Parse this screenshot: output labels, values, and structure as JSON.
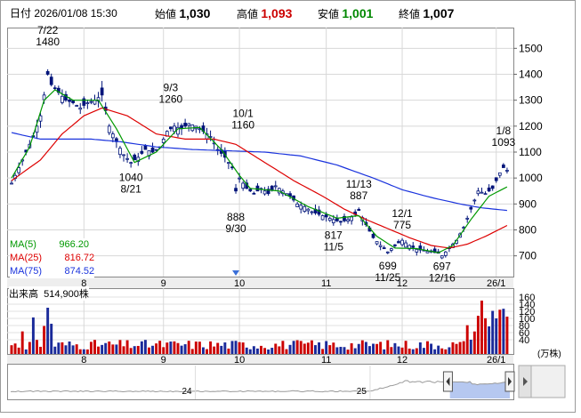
{
  "header": {
    "period": "日付",
    "datetime": "2026/01/08 15:30",
    "open_label": "始値",
    "open_value": "1,030",
    "high_label": "高値",
    "high_value": "1,093",
    "low_label": "安値",
    "low_value": "1,001",
    "close_label": "終値",
    "close_value": "1,007"
  },
  "colors": {
    "ma5": "#009900",
    "ma25": "#dd0000",
    "ma75": "#1a33dd",
    "up": "#ffffff",
    "down": "#00147a",
    "volume_up": "#cc0000",
    "volume_down": "#1a2a9a",
    "high_value": "#cc0000",
    "low_value": "#008800",
    "navigator_fill": "#b6c8f0"
  },
  "legend": [
    {
      "label": "MA(5)",
      "value": "966.20",
      "color": "#009900"
    },
    {
      "label": "MA(25)",
      "value": "816.72",
      "color": "#dd0000"
    },
    {
      "label": "MA(75)",
      "value": "874.52",
      "color": "#1a33dd"
    }
  ],
  "volume_label": "出来高",
  "volume_value": "514,900株",
  "chart_data": {
    "type": "candlestick",
    "ylim": [
      620,
      1580
    ],
    "yticks": [
      700,
      800,
      900,
      1000,
      1100,
      1200,
      1300,
      1400,
      1500
    ],
    "month_ticks": [
      {
        "label": "8",
        "index": 20
      },
      {
        "label": "9",
        "index": 42
      },
      {
        "label": "10",
        "index": 63
      },
      {
        "label": "11",
        "index": 87
      },
      {
        "label": "12",
        "index": 108
      },
      {
        "label": "26/1",
        "index": 134
      }
    ],
    "current_marker_index": 62,
    "annotations": [
      {
        "date": "7/22",
        "value": "1480",
        "index": 10,
        "position": "above"
      },
      {
        "date": "9/3",
        "value": "1260",
        "index": 44,
        "position": "above"
      },
      {
        "date": "10/1",
        "value": "1160",
        "index": 64,
        "position": "above"
      },
      {
        "date": "11/13",
        "value": "887",
        "index": 96,
        "position": "above"
      },
      {
        "date": "12/1",
        "value": "775",
        "index": 108,
        "position": "above"
      },
      {
        "date": "1/8",
        "value": "1093",
        "index": 136,
        "position": "above"
      },
      {
        "date": "8/21",
        "value": "1040",
        "index": 33,
        "position": "below"
      },
      {
        "date": "9/30",
        "value": "888",
        "index": 62,
        "position": "below"
      },
      {
        "date": "11/5",
        "value": "817",
        "index": 89,
        "position": "below"
      },
      {
        "date": "11/25",
        "value": "699",
        "index": 104,
        "position": "below"
      },
      {
        "date": "12/16",
        "value": "697",
        "index": 119,
        "position": "below"
      }
    ],
    "anchors_close": [
      [
        0,
        980
      ],
      [
        2,
        1040
      ],
      [
        4,
        1100
      ],
      [
        6,
        1160
      ],
      [
        8,
        1240
      ],
      [
        10,
        1400
      ],
      [
        11,
        1360
      ],
      [
        13,
        1330
      ],
      [
        15,
        1300
      ],
      [
        17,
        1290
      ],
      [
        19,
        1270
      ],
      [
        21,
        1290
      ],
      [
        23,
        1300
      ],
      [
        25,
        1320
      ],
      [
        27,
        1200
      ],
      [
        29,
        1140
      ],
      [
        31,
        1090
      ],
      [
        33,
        1060
      ],
      [
        35,
        1080
      ],
      [
        37,
        1110
      ],
      [
        39,
        1100
      ],
      [
        41,
        1120
      ],
      [
        43,
        1180
      ],
      [
        45,
        1200
      ],
      [
        47,
        1190
      ],
      [
        49,
        1210
      ],
      [
        51,
        1200
      ],
      [
        53,
        1180
      ],
      [
        55,
        1160
      ],
      [
        57,
        1110
      ],
      [
        59,
        1080
      ],
      [
        61,
        1040
      ],
      [
        62,
        950
      ],
      [
        63,
        1000
      ],
      [
        65,
        960
      ],
      [
        67,
        940
      ],
      [
        69,
        960
      ],
      [
        71,
        940
      ],
      [
        73,
        970
      ],
      [
        75,
        950
      ],
      [
        77,
        930
      ],
      [
        79,
        900
      ],
      [
        81,
        890
      ],
      [
        83,
        870
      ],
      [
        85,
        860
      ],
      [
        87,
        850
      ],
      [
        89,
        840
      ],
      [
        91,
        830
      ],
      [
        93,
        840
      ],
      [
        95,
        860
      ],
      [
        96,
        875
      ],
      [
        98,
        820
      ],
      [
        100,
        770
      ],
      [
        102,
        740
      ],
      [
        104,
        715
      ],
      [
        106,
        740
      ],
      [
        108,
        760
      ],
      [
        110,
        740
      ],
      [
        112,
        725
      ],
      [
        114,
        720
      ],
      [
        116,
        715
      ],
      [
        118,
        710
      ],
      [
        119,
        700
      ],
      [
        121,
        730
      ],
      [
        123,
        760
      ],
      [
        125,
        810
      ],
      [
        127,
        880
      ],
      [
        129,
        950
      ],
      [
        131,
        940
      ],
      [
        133,
        960
      ],
      [
        135,
        1020
      ],
      [
        136,
        1040
      ],
      [
        137,
        1030
      ]
    ],
    "ma5_anchors": [
      [
        0,
        1000
      ],
      [
        5,
        1120
      ],
      [
        9,
        1300
      ],
      [
        12,
        1340
      ],
      [
        17,
        1300
      ],
      [
        24,
        1300
      ],
      [
        29,
        1190
      ],
      [
        34,
        1060
      ],
      [
        40,
        1100
      ],
      [
        46,
        1190
      ],
      [
        52,
        1195
      ],
      [
        58,
        1110
      ],
      [
        63,
        1010
      ],
      [
        66,
        960
      ],
      [
        74,
        950
      ],
      [
        82,
        890
      ],
      [
        90,
        845
      ],
      [
        96,
        855
      ],
      [
        101,
        775
      ],
      [
        106,
        730
      ],
      [
        112,
        728
      ],
      [
        118,
        712
      ],
      [
        122,
        740
      ],
      [
        127,
        840
      ],
      [
        132,
        930
      ],
      [
        137,
        966
      ]
    ],
    "ma25_anchors": [
      [
        0,
        990
      ],
      [
        8,
        1070
      ],
      [
        14,
        1170
      ],
      [
        20,
        1240
      ],
      [
        25,
        1270
      ],
      [
        32,
        1240
      ],
      [
        40,
        1170
      ],
      [
        48,
        1150
      ],
      [
        56,
        1150
      ],
      [
        62,
        1130
      ],
      [
        70,
        1060
      ],
      [
        78,
        990
      ],
      [
        86,
        930
      ],
      [
        92,
        880
      ],
      [
        98,
        840
      ],
      [
        104,
        805
      ],
      [
        110,
        770
      ],
      [
        116,
        740
      ],
      [
        121,
        730
      ],
      [
        126,
        745
      ],
      [
        131,
        775
      ],
      [
        137,
        817
      ]
    ],
    "ma75_anchors": [
      [
        0,
        1175
      ],
      [
        8,
        1150
      ],
      [
        14,
        1150
      ],
      [
        22,
        1150
      ],
      [
        30,
        1140
      ],
      [
        40,
        1120
      ],
      [
        50,
        1110
      ],
      [
        60,
        1105
      ],
      [
        70,
        1100
      ],
      [
        80,
        1085
      ],
      [
        90,
        1050
      ],
      [
        100,
        1000
      ],
      [
        108,
        955
      ],
      [
        116,
        925
      ],
      [
        124,
        900
      ],
      [
        130,
        885
      ],
      [
        137,
        875
      ]
    ],
    "volume": {
      "ylim": [
        0,
        185
      ],
      "yticks": [
        40,
        60,
        80,
        100,
        120,
        140,
        160
      ],
      "unit": "(万株)"
    },
    "navigator": {
      "labels": [
        {
          "text": "24",
          "position": 0.37
        },
        {
          "text": "25",
          "position": 0.72
        }
      ],
      "window_start": 0.876,
      "window_end": 1.0
    }
  }
}
